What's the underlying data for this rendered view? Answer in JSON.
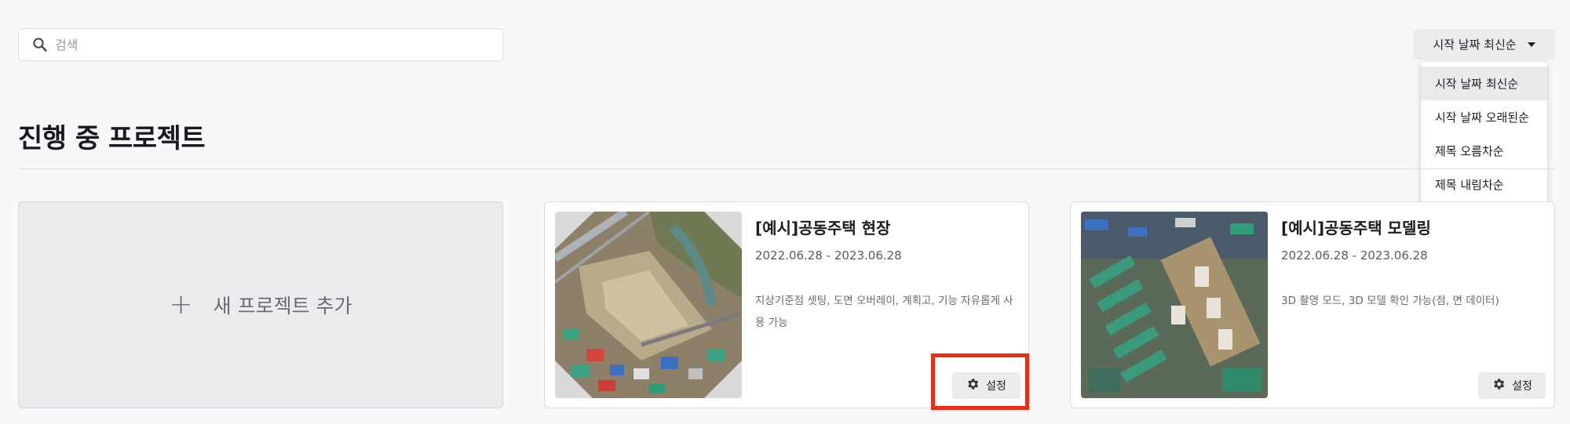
{
  "search": {
    "placeholder": "검색",
    "value": ""
  },
  "sort": {
    "current": "시작 날짜 최신순",
    "options": [
      "시작 날짜 최신순",
      "시작 날짜 오래된순",
      "제목 오름차순",
      "제목 내림차순"
    ]
  },
  "section": {
    "title": "진행 중 프로젝트"
  },
  "add_project": {
    "plus": "+",
    "label": "새 프로젝트 추가"
  },
  "projects": [
    {
      "title": "[예시]공동주택 현장",
      "date": "2022.06.28 - 2023.06.28",
      "description": "지상기준점 셋팅, 도면 오버레이, 계획고, 기능 자유롭게 사용 가능",
      "settings_label": "설정"
    },
    {
      "title": "[예시]공동주택 모델링",
      "date": "2022.06.28 - 2023.06.28",
      "description": "3D 촬영 모드, 3D 모델 확인 가능(점, 면 데이터)",
      "settings_label": "설정"
    }
  ],
  "colors": {
    "highlight": "#ee2c14",
    "background": "#f8f8fa"
  },
  "icons": {
    "search": "search-icon",
    "settings": "gear-icon",
    "dropdown": "caret-down-icon",
    "add": "plus-icon"
  }
}
